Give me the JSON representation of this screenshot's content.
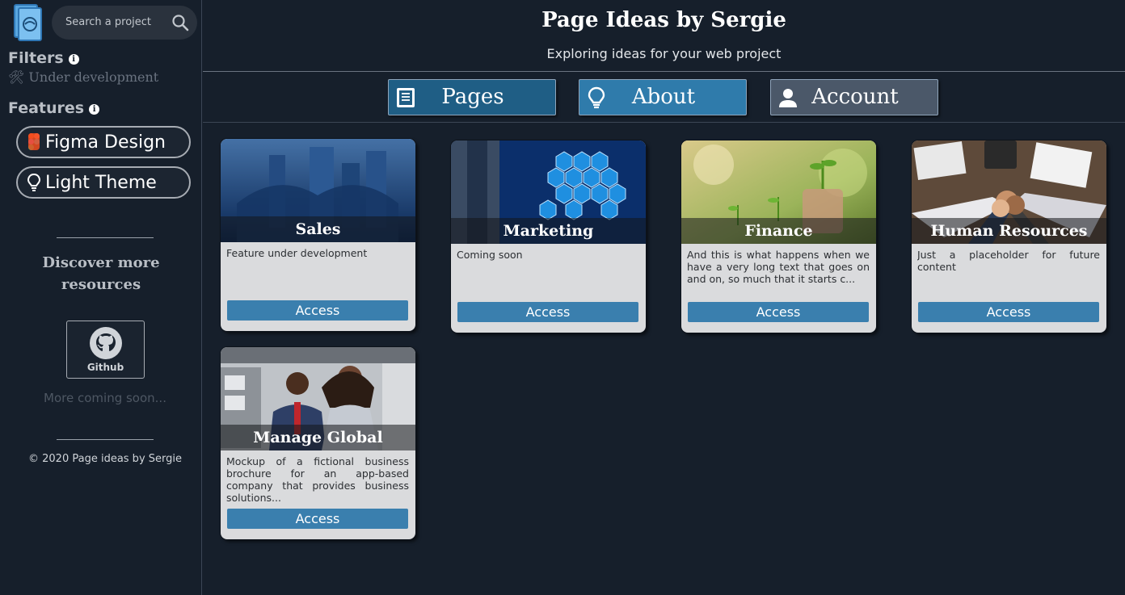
{
  "sidebar": {
    "search_placeholder": "Search a project",
    "filters_heading": "Filters",
    "filters_status": "🛠 Under development",
    "features_heading": "Features",
    "features": [
      {
        "label": "Figma Design",
        "icon": "figma-icon"
      },
      {
        "label": "Light Theme",
        "icon": "lightbulb-icon"
      }
    ],
    "discover_heading": "Discover more resources",
    "github_label": "Github",
    "more_coming": "More coming soon...",
    "copyright": "© 2020 Page ideas by Sergie"
  },
  "header": {
    "title": "Page Ideas by Sergie",
    "subtitle": "Exploring ideas for your web project"
  },
  "nav": [
    {
      "label": "Pages",
      "icon": "document-icon",
      "color": "#1f5e85"
    },
    {
      "label": "About",
      "icon": "lightbulb-icon",
      "color": "#2f7bab"
    },
    {
      "label": "Account",
      "icon": "user-icon",
      "color": "#4b5869"
    }
  ],
  "cards": [
    {
      "title": "Sales",
      "description": "Feature under development",
      "button": "Access"
    },
    {
      "title": "Marketing",
      "description": "Coming soon",
      "button": "Access"
    },
    {
      "title": "Finance",
      "description": "And this is what happens when we have a very long text that goes on and on, so much that it starts c...",
      "button": "Access"
    },
    {
      "title": "Human Resources",
      "description": "Just a placeholder for future content",
      "button": "Access"
    },
    {
      "title": "Manage Global",
      "description": "Mockup of a fictional business brochure for an app-based company that provides business solutions...",
      "button": "Access"
    }
  ],
  "colors": {
    "background": "#161f2b",
    "accent": "#3a7fae",
    "card": "#dadbdd"
  }
}
